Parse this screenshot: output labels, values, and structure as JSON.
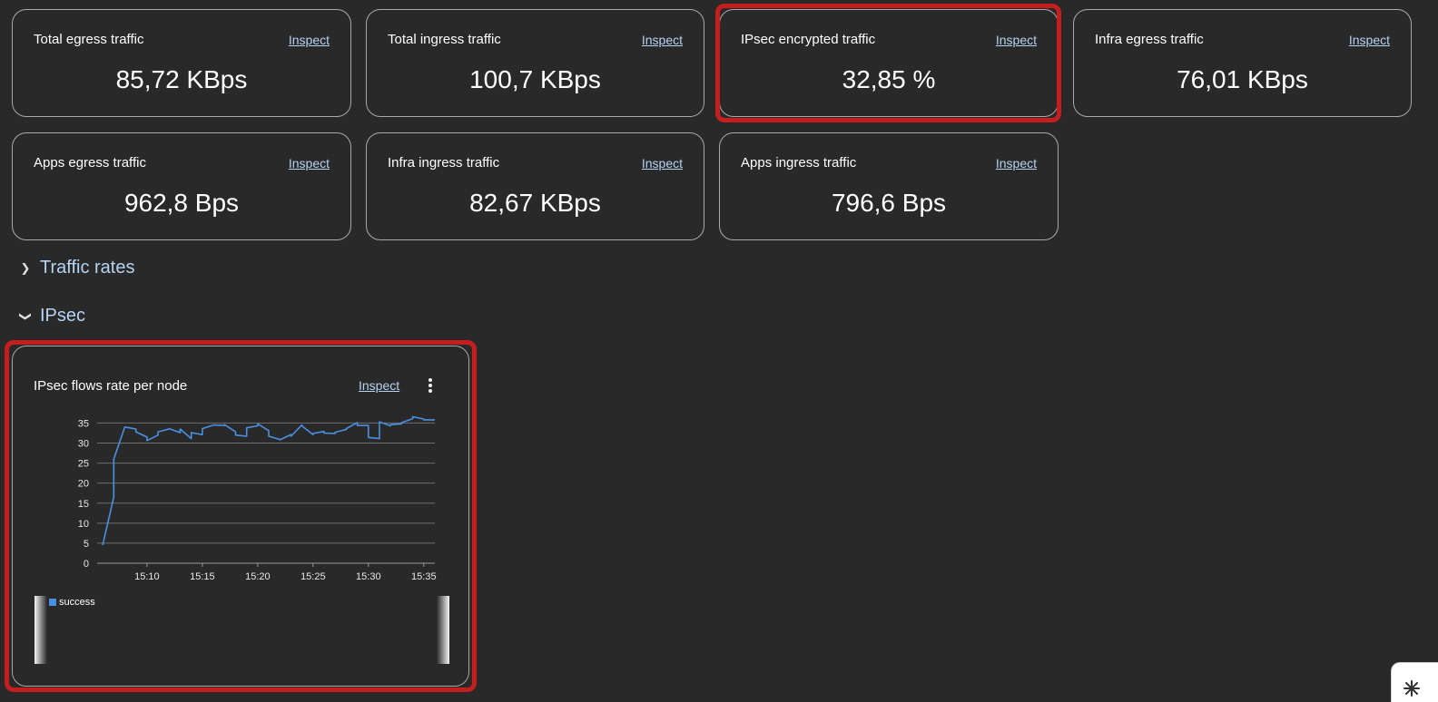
{
  "stats": [
    {
      "title": "Total egress traffic",
      "value": "85,72 KBps",
      "link": "Inspect"
    },
    {
      "title": "Total ingress traffic",
      "value": "100,7 KBps",
      "link": "Inspect"
    },
    {
      "title": "IPsec encrypted traffic",
      "value": "32,85 %",
      "link": "Inspect"
    },
    {
      "title": "Infra egress traffic",
      "value": "76,01 KBps",
      "link": "Inspect"
    },
    {
      "title": "Apps egress traffic",
      "value": "962,8 Bps",
      "link": "Inspect"
    },
    {
      "title": "Infra ingress traffic",
      "value": "82,67 KBps",
      "link": "Inspect"
    },
    {
      "title": "Apps ingress traffic",
      "value": "796,6 Bps",
      "link": "Inspect"
    }
  ],
  "sections": {
    "traffic_rates": {
      "label": "Traffic rates",
      "expanded": false
    },
    "ipsec": {
      "label": "IPsec",
      "expanded": true
    }
  },
  "chart_panel": {
    "title": "IPsec flows rate per node",
    "link": "Inspect",
    "menu_icon": "kebab-vertical-icon"
  },
  "colors": {
    "background": "#292929",
    "card_border": "#a9a9a9",
    "link": "#b5d3f2",
    "highlight": "#c41e1e",
    "series": "#4a90e2"
  },
  "chart_data": {
    "type": "line",
    "title": "",
    "xlabel": "",
    "ylabel": "",
    "x_ticks": [
      "15:10",
      "15:15",
      "15:20",
      "15:25",
      "15:30",
      "15:35"
    ],
    "y_ticks": [
      0,
      5,
      10,
      15,
      20,
      25,
      30,
      35
    ],
    "ylim": [
      0,
      36
    ],
    "grid": true,
    "legend_position": "bottom-left",
    "series": [
      {
        "name": "success",
        "x": [
          "15:06",
          "15:07",
          "15:07",
          "15:08",
          "15:09",
          "15:09",
          "15:10",
          "15:10",
          "15:11",
          "15:11",
          "15:12",
          "15:12",
          "15:13",
          "15:13",
          "15:14",
          "15:14",
          "15:15",
          "15:15",
          "15:16",
          "15:16",
          "15:17",
          "15:17",
          "15:18",
          "15:18",
          "15:19",
          "15:19",
          "15:20",
          "15:20",
          "15:21",
          "15:21",
          "15:22",
          "15:22",
          "15:23",
          "15:23",
          "15:24",
          "15:24",
          "15:25",
          "15:25",
          "15:26",
          "15:26",
          "15:27",
          "15:27",
          "15:28",
          "15:28",
          "15:29",
          "15:29",
          "15:30",
          "15:30",
          "15:31",
          "15:31",
          "15:32",
          "15:32",
          "15:33",
          "15:33",
          "15:34",
          "15:34",
          "15:35",
          "15:35",
          "15:36"
        ],
        "values": [
          4.5,
          16.5,
          26,
          34,
          33.5,
          32.8,
          31.5,
          30.6,
          32,
          32.8,
          33.5,
          33.6,
          32.6,
          33.5,
          31.1,
          32.6,
          32.1,
          33.6,
          34.5,
          34.5,
          34.4,
          34.6,
          32.8,
          32,
          31.7,
          33.8,
          34.3,
          34.8,
          33.1,
          31.7,
          30.9,
          30.8,
          32.1,
          31.7,
          34.5,
          34.3,
          32.1,
          32.4,
          32.9,
          32.5,
          32.4,
          32.7,
          33.4,
          33.6,
          35.1,
          34.4,
          34.4,
          31.4,
          31.1,
          35.3,
          34.3,
          34.6,
          34.8,
          35.1,
          36.1,
          36.6,
          36,
          35.8,
          35.8
        ]
      }
    ]
  }
}
